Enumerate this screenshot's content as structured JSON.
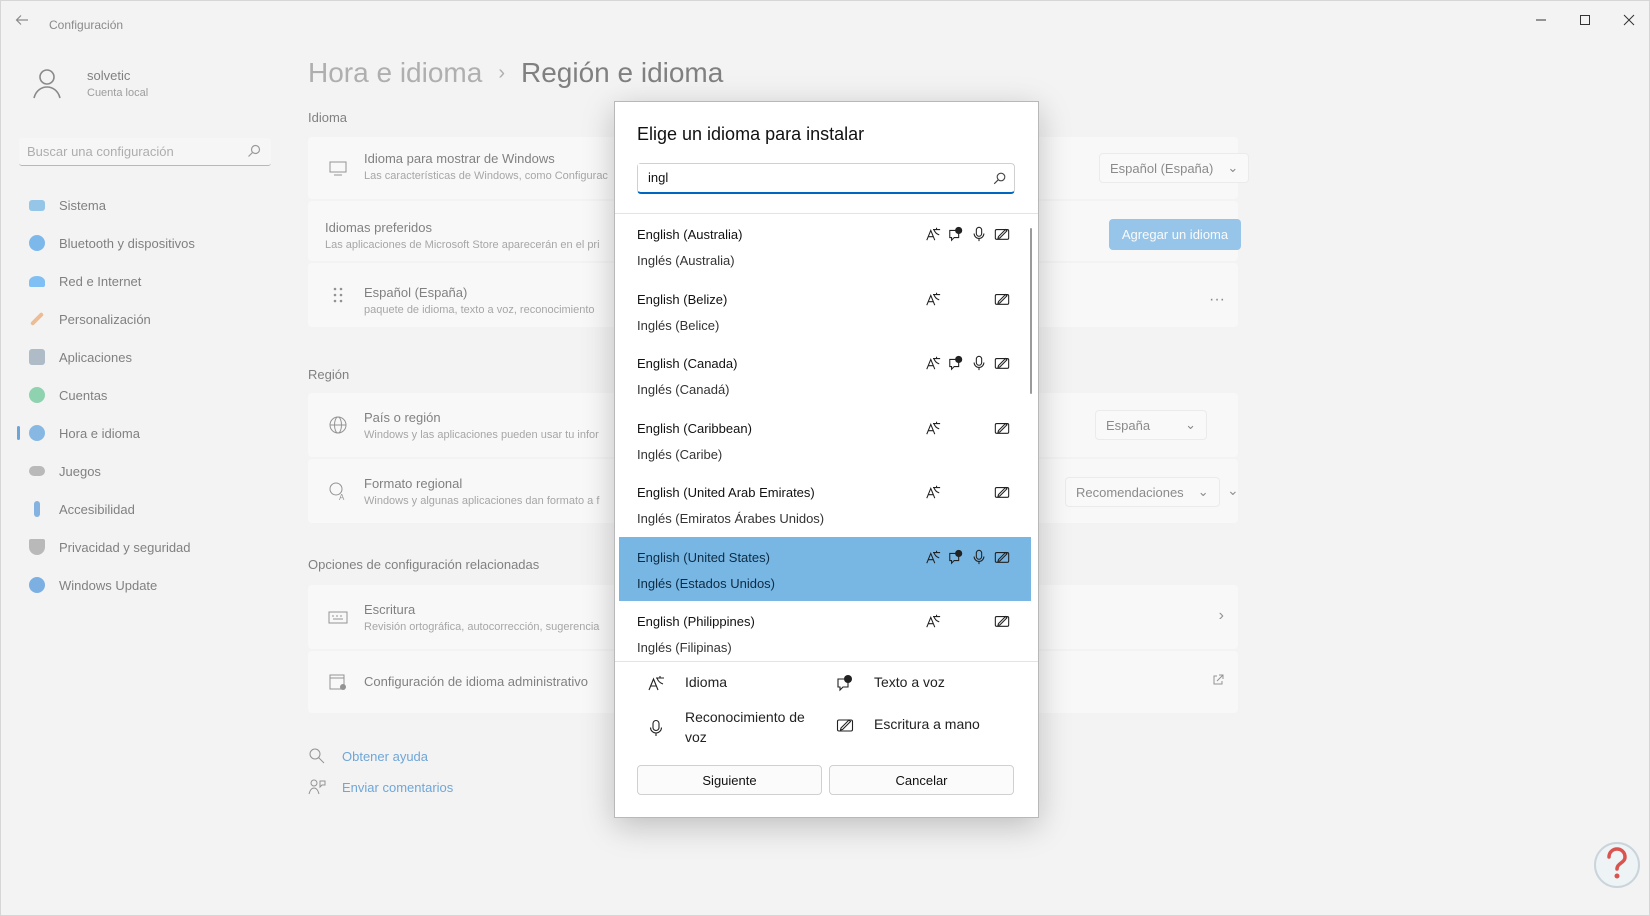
{
  "window": {
    "title": "Configuración",
    "back_icon": "back-arrow-icon",
    "controls": [
      "minimize-icon",
      "maximize-icon",
      "close-icon"
    ]
  },
  "user": {
    "name": "solvetic",
    "account_type": "Cuenta local"
  },
  "sidebar": {
    "search_placeholder": "Buscar una configuración",
    "items": [
      {
        "label": "Sistema",
        "icon": "monitor-icon",
        "color": "#4aa3df"
      },
      {
        "label": "Bluetooth y dispositivos",
        "icon": "bluetooth-icon",
        "color": "#1e88e5"
      },
      {
        "label": "Red e Internet",
        "icon": "wifi-icon",
        "color": "#2196f3"
      },
      {
        "label": "Personalización",
        "icon": "brush-icon",
        "color": "#e8904a"
      },
      {
        "label": "Aplicaciones",
        "icon": "apps-icon",
        "color": "#7a8fa6"
      },
      {
        "label": "Cuentas",
        "icon": "person-icon",
        "color": "#3cb878"
      },
      {
        "label": "Hora e idioma",
        "icon": "globe-clock-icon",
        "color": "#2f89d6",
        "active": true
      },
      {
        "label": "Juegos",
        "icon": "gamepad-icon",
        "color": "#8a8a8a"
      },
      {
        "label": "Accesibilidad",
        "icon": "accessibility-icon",
        "color": "#2d7fd3"
      },
      {
        "label": "Privacidad y seguridad",
        "icon": "shield-icon",
        "color": "#8a8a8a"
      },
      {
        "label": "Windows Update",
        "icon": "update-icon",
        "color": "#1b7ad6"
      }
    ]
  },
  "breadcrumb": {
    "parent": "Hora e idioma",
    "current": "Región e idioma"
  },
  "main": {
    "language_section": "Idioma",
    "display_language": {
      "title": "Idioma para mostrar de Windows",
      "subtitle": "Las características de Windows, como Configurac",
      "value": "Español (España)"
    },
    "preferred": {
      "title": "Idiomas preferidos",
      "subtitle": "Las aplicaciones de Microsoft Store aparecerán en el pri",
      "button": "Agregar un idioma"
    },
    "spanish": {
      "title": "Español (España)",
      "subtitle": "paquete de idioma, texto a voz, reconocimiento",
      "more": "···"
    },
    "region_section": "Región",
    "country": {
      "title": "País o región",
      "subtitle": "Windows y las aplicaciones pueden usar tu infor",
      "value": "España"
    },
    "regional_format": {
      "title": "Formato regional",
      "subtitle": "Windows y algunas aplicaciones dan formato a f",
      "value": "Recomendaciones"
    },
    "related_section": "Opciones de configuración relacionadas",
    "typing": {
      "title": "Escritura",
      "subtitle": "Revisión ortográfica, autocorrección, sugerencia"
    },
    "admin": {
      "title": "Configuración de idioma administrativo"
    },
    "help": "Obtener ayuda",
    "feedback": "Enviar comentarios"
  },
  "dialog": {
    "title": "Elige un idioma para instalar",
    "search_value": "ingl",
    "languages": [
      {
        "name": "English (Australia)",
        "localized": "Inglés (Australia)",
        "features": [
          true,
          true,
          true,
          true
        ],
        "selected": false
      },
      {
        "name": "English (Belize)",
        "localized": "Inglés (Belice)",
        "features": [
          true,
          false,
          false,
          true
        ],
        "selected": false
      },
      {
        "name": "English (Canada)",
        "localized": "Inglés (Canadá)",
        "features": [
          true,
          true,
          true,
          true
        ],
        "selected": false
      },
      {
        "name": "English (Caribbean)",
        "localized": "Inglés (Caribe)",
        "features": [
          true,
          false,
          false,
          true
        ],
        "selected": false
      },
      {
        "name": "English (United Arab Emirates)",
        "localized": "Inglés (Emiratos Árabes Unidos)",
        "features": [
          true,
          false,
          false,
          true
        ],
        "selected": false
      },
      {
        "name": "English (United States)",
        "localized": "Inglés (Estados Unidos)",
        "features": [
          true,
          true,
          true,
          true
        ],
        "selected": true
      },
      {
        "name": "English (Philippines)",
        "localized": "Inglés (Filipinas)",
        "features": [
          true,
          false,
          false,
          true
        ],
        "selected": false
      }
    ],
    "legend": {
      "language": "Idioma",
      "tts": "Texto a voz",
      "speech": "Reconocimiento de voz",
      "handwriting": "Escritura a mano"
    },
    "buttons": {
      "next": "Siguiente",
      "cancel": "Cancelar"
    },
    "selection_color": "#78b7e4"
  }
}
